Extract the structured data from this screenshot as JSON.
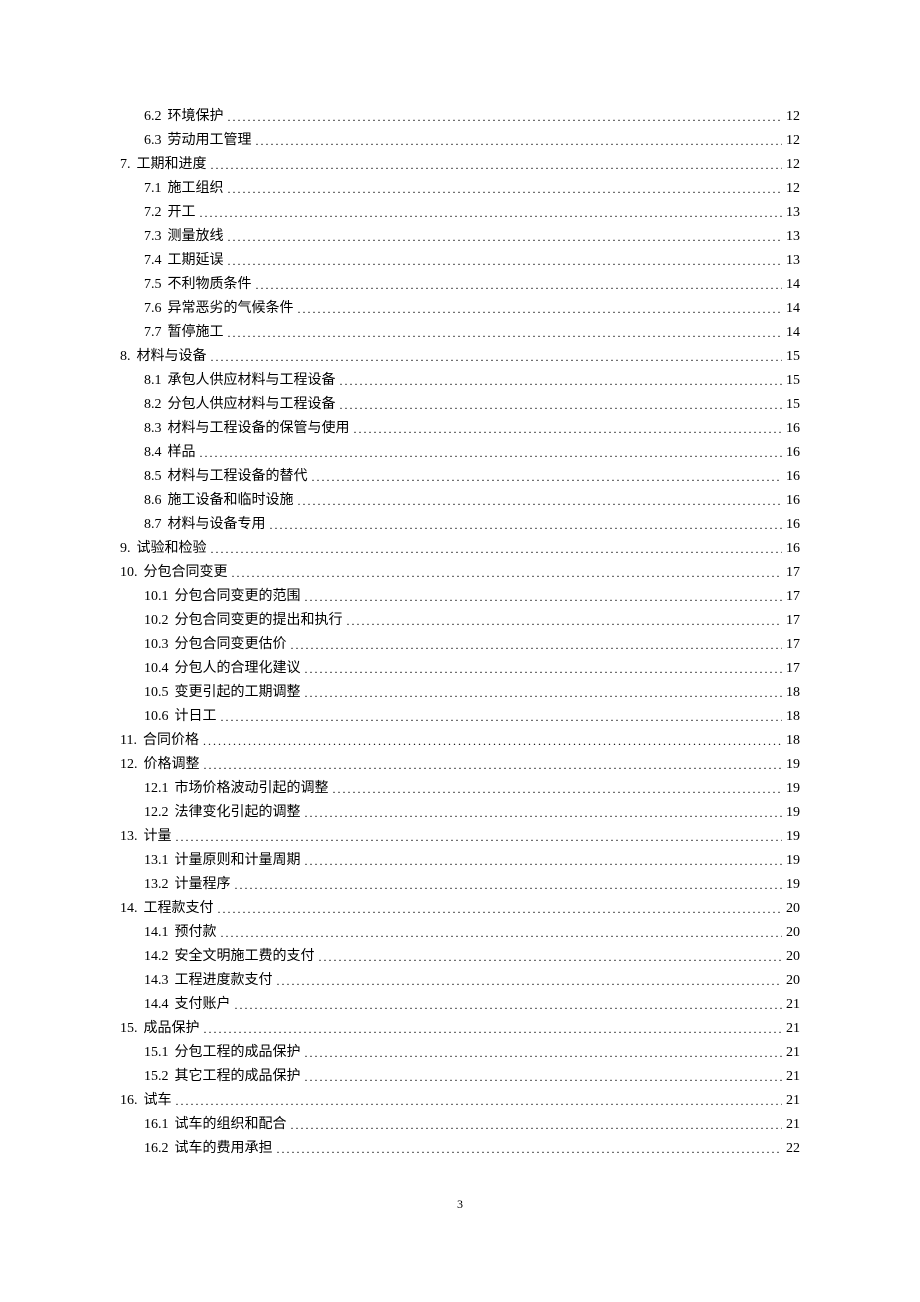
{
  "page_number": "3",
  "toc": [
    {
      "level": 2,
      "num": "6.2",
      "text": "环境保护",
      "page": "12"
    },
    {
      "level": 2,
      "num": "6.3",
      "text": "劳动用工管理",
      "page": "12"
    },
    {
      "level": 1,
      "num": "7.",
      "text": "工期和进度",
      "page": "12"
    },
    {
      "level": 2,
      "num": "7.1",
      "text": "施工组织",
      "page": "12"
    },
    {
      "level": 2,
      "num": "7.2",
      "text": "开工",
      "page": "13"
    },
    {
      "level": 2,
      "num": "7.3",
      "text": "测量放线",
      "page": "13"
    },
    {
      "level": 2,
      "num": "7.4",
      "text": "工期延误",
      "page": "13"
    },
    {
      "level": 2,
      "num": "7.5",
      "text": "不利物质条件",
      "page": "14"
    },
    {
      "level": 2,
      "num": "7.6",
      "text": "异常恶劣的气候条件",
      "page": "14"
    },
    {
      "level": 2,
      "num": "7.7",
      "text": "暂停施工",
      "page": "14"
    },
    {
      "level": 1,
      "num": "8.",
      "text": "材料与设备",
      "page": "15"
    },
    {
      "level": 2,
      "num": "8.1",
      "text": "承包人供应材料与工程设备",
      "page": "15"
    },
    {
      "level": 2,
      "num": "8.2",
      "text": "分包人供应材料与工程设备",
      "page": "15"
    },
    {
      "level": 2,
      "num": "8.3",
      "text": "材料与工程设备的保管与使用",
      "page": "16"
    },
    {
      "level": 2,
      "num": "8.4",
      "text": "样品",
      "page": "16"
    },
    {
      "level": 2,
      "num": "8.5",
      "text": "材料与工程设备的替代",
      "page": "16"
    },
    {
      "level": 2,
      "num": "8.6",
      "text": "施工设备和临时设施",
      "page": "16"
    },
    {
      "level": 2,
      "num": "8.7",
      "text": "材料与设备专用",
      "page": "16"
    },
    {
      "level": 1,
      "num": "9.",
      "text": "试验和检验",
      "page": "16"
    },
    {
      "level": 1,
      "num": "10.",
      "text": "分包合同变更",
      "page": "17"
    },
    {
      "level": 2,
      "num": "10.1",
      "text": "分包合同变更的范围",
      "page": "17"
    },
    {
      "level": 2,
      "num": "10.2",
      "text": "分包合同变更的提出和执行",
      "page": "17"
    },
    {
      "level": 2,
      "num": "10.3",
      "text": "分包合同变更估价",
      "page": "17"
    },
    {
      "level": 2,
      "num": "10.4",
      "text": "分包人的合理化建议",
      "page": "17"
    },
    {
      "level": 2,
      "num": "10.5",
      "text": "变更引起的工期调整",
      "page": "18"
    },
    {
      "level": 2,
      "num": "10.6",
      "text": "计日工",
      "page": "18"
    },
    {
      "level": 1,
      "num": "11.",
      "text": "合同价格",
      "page": "18"
    },
    {
      "level": 1,
      "num": "12.",
      "text": "价格调整",
      "page": "19"
    },
    {
      "level": 2,
      "num": "12.1",
      "text": "市场价格波动引起的调整",
      "page": "19"
    },
    {
      "level": 2,
      "num": "12.2",
      "text": "法律变化引起的调整",
      "page": "19"
    },
    {
      "level": 1,
      "num": "13.",
      "text": "计量",
      "page": "19"
    },
    {
      "level": 2,
      "num": "13.1",
      "text": "计量原则和计量周期",
      "page": "19"
    },
    {
      "level": 2,
      "num": "13.2",
      "text": "计量程序",
      "page": "19"
    },
    {
      "level": 1,
      "num": "14.",
      "text": "工程款支付",
      "page": "20"
    },
    {
      "level": 2,
      "num": "14.1",
      "text": "预付款",
      "page": "20"
    },
    {
      "level": 2,
      "num": "14.2",
      "text": "安全文明施工费的支付",
      "page": "20"
    },
    {
      "level": 2,
      "num": "14.3",
      "text": "工程进度款支付",
      "page": "20"
    },
    {
      "level": 2,
      "num": "14.4",
      "text": "支付账户",
      "page": "21"
    },
    {
      "level": 1,
      "num": "15.",
      "text": "成品保护",
      "page": "21"
    },
    {
      "level": 2,
      "num": "15.1",
      "text": "分包工程的成品保护",
      "page": "21"
    },
    {
      "level": 2,
      "num": "15.2",
      "text": "其它工程的成品保护",
      "page": "21"
    },
    {
      "level": 1,
      "num": "16.",
      "text": "试车",
      "page": "21"
    },
    {
      "level": 2,
      "num": "16.1",
      "text": "试车的组织和配合",
      "page": "21"
    },
    {
      "level": 2,
      "num": "16.2",
      "text": "试车的费用承担",
      "page": "22"
    }
  ]
}
